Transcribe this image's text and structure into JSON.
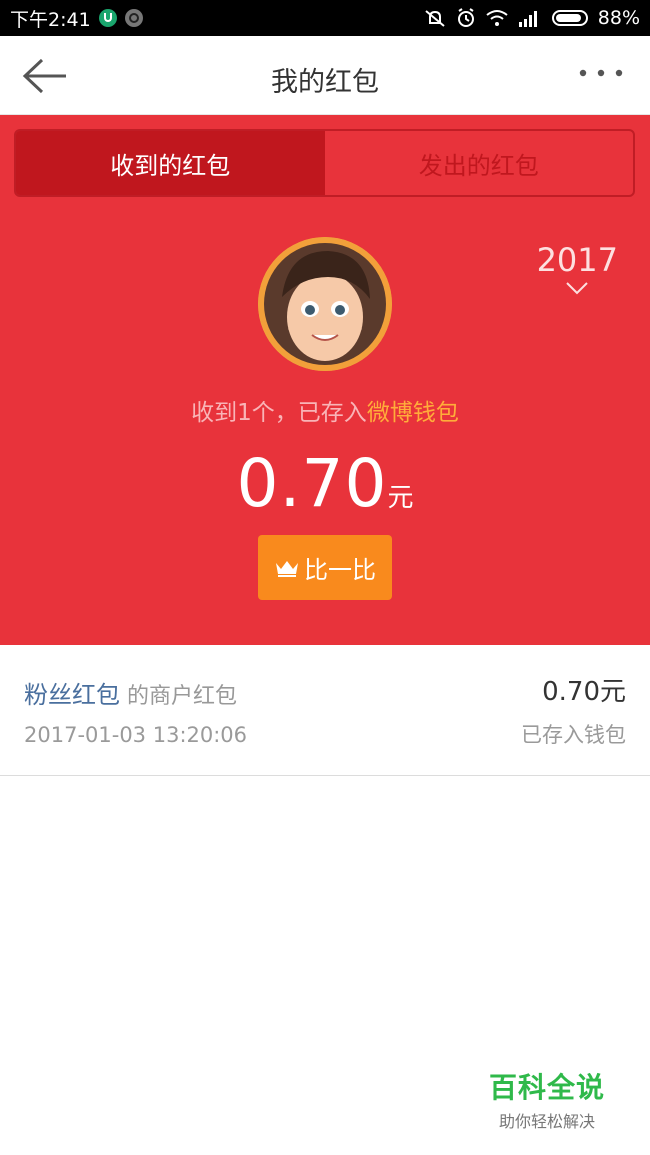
{
  "status_bar": {
    "time": "下午2:41",
    "battery": "88%"
  },
  "header": {
    "title": "我的红包"
  },
  "tabs": [
    {
      "label": "收到的红包",
      "active": true
    },
    {
      "label": "发出的红包",
      "active": false
    }
  ],
  "year_selector": {
    "value": "2017"
  },
  "summary": {
    "received_text": "收到1个，已存入",
    "wallet_link": "微博钱包",
    "amount": "0.70",
    "unit": "元",
    "compare_button": "比一比"
  },
  "records": [
    {
      "source": "粉丝红包",
      "type": "的商户红包",
      "time": "2017-01-03 13:20:06",
      "amount": "0.70元",
      "status": "已存入钱包"
    }
  ],
  "watermark": {
    "brand": "百科全说",
    "tagline": "助你轻松解决"
  },
  "colors": {
    "red": "#e8333b",
    "dark_red": "#c0171e",
    "orange": "#f98a1d",
    "link_blue": "#4a6f9e"
  }
}
